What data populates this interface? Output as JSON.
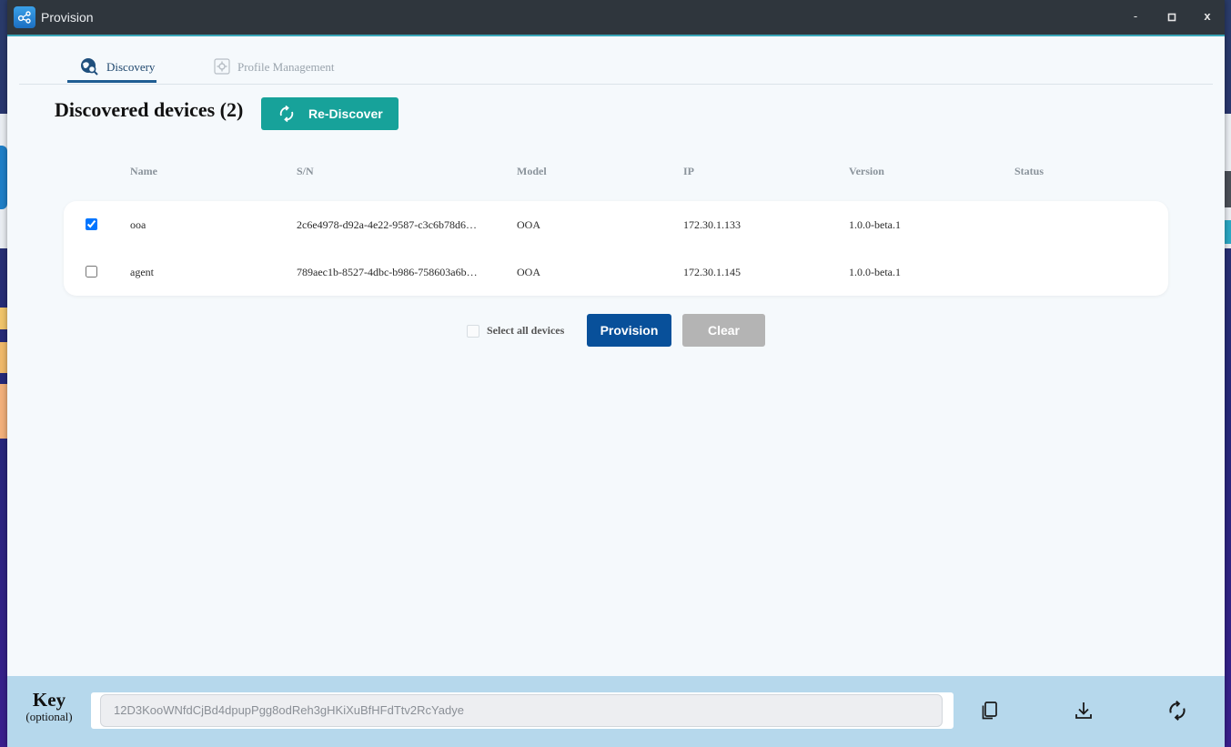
{
  "window": {
    "title": "Provision",
    "controls": {
      "minimize": "-",
      "maximize": "□",
      "close": "x"
    }
  },
  "tabs": [
    {
      "label": "Discovery",
      "icon": "globe-search-icon",
      "active": true
    },
    {
      "label": "Profile Management",
      "icon": "gear-icon",
      "active": false
    }
  ],
  "discovery": {
    "heading": "Discovered devices (2)",
    "rediscover_label": "Re-Discover",
    "columns": [
      "Name",
      "S/N",
      "Model",
      "IP",
      "Version",
      "Status"
    ],
    "devices": [
      {
        "checked": true,
        "name": "ooa",
        "sn": "2c6e4978-d92a-4e22-9587-c3c6b78d6…",
        "model": "OOA",
        "ip": "172.30.1.133",
        "version": "1.0.0-beta.1",
        "status": ""
      },
      {
        "checked": false,
        "name": "agent",
        "sn": "789aec1b-8527-4dbc-b986-758603a6b…",
        "model": "OOA",
        "ip": "172.30.1.145",
        "version": "1.0.0-beta.1",
        "status": ""
      }
    ],
    "select_all_label": "Select all devices",
    "provision_label": "Provision",
    "clear_label": "Clear"
  },
  "footer": {
    "key_title": "Key",
    "key_subtitle": "(optional)",
    "key_value": "12D3KooWNfdCjBd4dpupPgg8odReh3gHKiXuBfHFdTtv2RcYadye",
    "icons": [
      "copy-icon",
      "download-icon",
      "refresh-icon"
    ]
  },
  "colors": {
    "titlebar": "#2f363d",
    "accent_teal": "#17a29a",
    "primary_blue": "#08509a",
    "disabled_gray": "#b4b4b4",
    "footer_bg": "#b6d8ec"
  }
}
